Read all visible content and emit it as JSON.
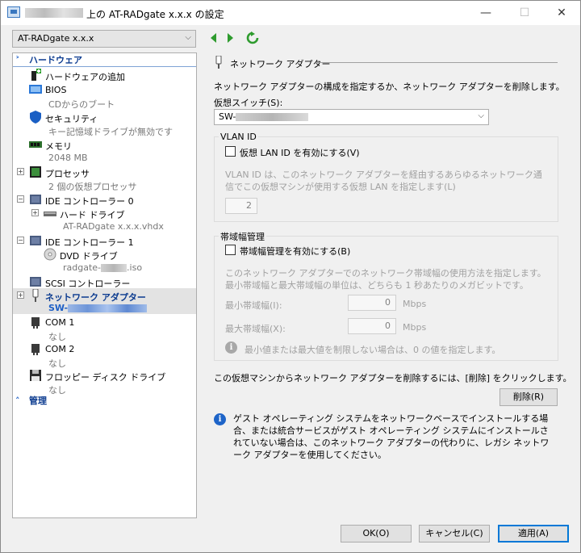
{
  "window": {
    "title": "上の AT-RADgate x.x.x の設定",
    "minimize": "—",
    "maximize": "☐",
    "close": "✕"
  },
  "toolbar": {
    "vm_name": "AT-RADgate x.x.x"
  },
  "sidebar": {
    "hardware_header": "ハードウェア",
    "management_header": "管理",
    "items": [
      {
        "label": "ハードウェアの追加"
      },
      {
        "label": "BIOS",
        "sub": "CDからのブート"
      },
      {
        "label": "セキュリティ",
        "sub": "キー記憶域ドライブが無効です"
      },
      {
        "label": "メモリ",
        "sub": "2048 MB"
      },
      {
        "label": "プロセッサ",
        "sub": "2 個の仮想プロセッサ"
      },
      {
        "label": "IDE コントローラー 0"
      },
      {
        "label": "ハード ドライブ",
        "sub": "AT-RADgate x.x.x.vhdx"
      },
      {
        "label": "IDE コントローラー 1"
      },
      {
        "label": "DVD ドライブ",
        "sub_prefix": "radgate-",
        "sub_suffix": ".iso"
      },
      {
        "label": "SCSI コントローラー"
      },
      {
        "label": "ネットワーク アダプター",
        "sub_prefix": "SW-"
      },
      {
        "label": "COM 1",
        "sub": "なし"
      },
      {
        "label": "COM 2",
        "sub": "なし"
      },
      {
        "label": "フロッピー ディスク ドライブ",
        "sub": "なし"
      }
    ]
  },
  "main": {
    "section_title": "ネットワーク アダプター",
    "description": "ネットワーク アダプターの構成を指定するか、ネットワーク アダプターを削除します。",
    "virtual_switch_label": "仮想スイッチ(S):",
    "virtual_switch_value": "SW-",
    "vlan": {
      "group_label": "VLAN ID",
      "checkbox_label": "仮想 LAN ID を有効にする(V)",
      "checked": false,
      "help_text": "VLAN ID は、このネットワーク アダプターを経由するあらゆるネットワーク通信でこの仮想マシンが使用する仮想 LAN を指定します(L)",
      "value": "2"
    },
    "bandwidth": {
      "group_label": "帯域幅管理",
      "checkbox_label": "帯域幅管理を有効にする(B)",
      "checked": false,
      "help_text": "このネットワーク アダプターでのネットワーク帯域幅の使用方法を指定します。最小帯域幅と最大帯域幅の単位は、どちらも 1 秒あたりのメガビットです。",
      "min_label": "最小帯域幅(I):",
      "min_value": "0",
      "max_label": "最大帯域幅(X):",
      "max_value": "0",
      "unit": "Mbps",
      "note": "最小値または最大値を制限しない場合は、0 の値を指定します。"
    },
    "remove_text": "この仮想マシンからネットワーク アダプターを削除するには、[削除] をクリックします。",
    "remove_button": "削除(R)",
    "info_text": "ゲスト オペレーティング システムをネットワークベースでインストールする場合、または統合サービスがゲスト オペレーティング システムにインストールされていない場合は、このネットワーク アダプターの代わりに、レガシ ネットワーク アダプターを使用してください。"
  },
  "footer": {
    "ok": "OK(O)",
    "cancel": "キャンセル(C)",
    "apply": "適用(A)"
  },
  "colors": {
    "accent": "#0078d7",
    "link": "#0a3a8f",
    "selection": "#e3e3e3"
  }
}
